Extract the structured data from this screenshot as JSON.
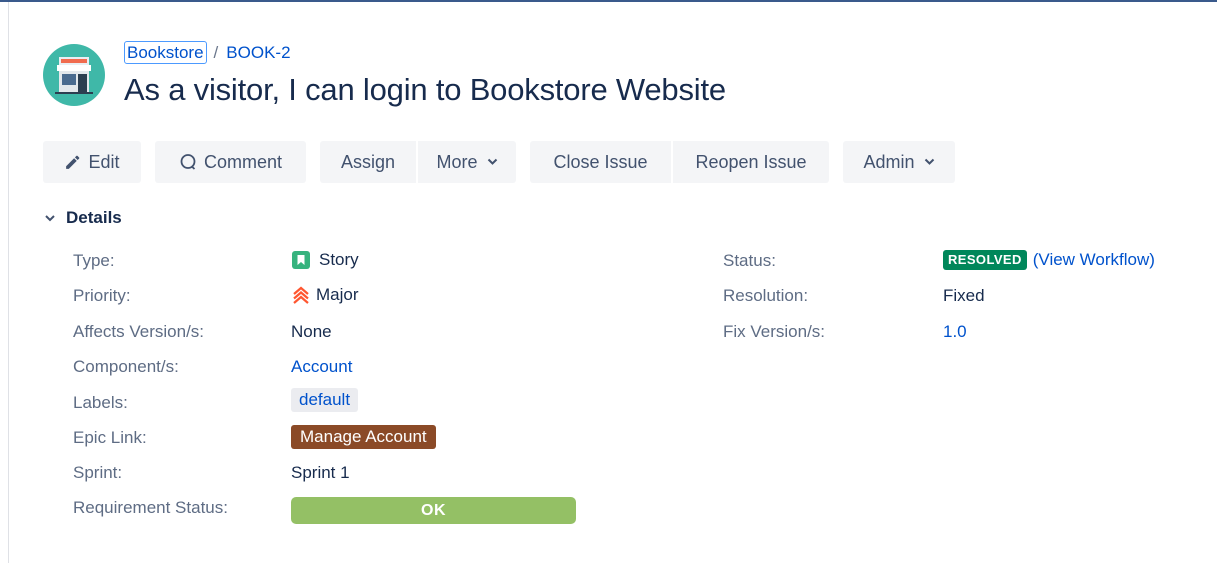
{
  "breadcrumb": {
    "project": "Bookstore",
    "separator": "/",
    "issue_key": "BOOK-2"
  },
  "issue": {
    "title": "As a visitor, I can login to Bookstore Website"
  },
  "avatar": {
    "icon": "bookstore-storefront-icon",
    "color": "#3fb8a8"
  },
  "toolbar": {
    "edit": {
      "label": "Edit",
      "icon": "pencil-icon"
    },
    "comment": {
      "label": "Comment",
      "icon": "comment-icon"
    },
    "assign": {
      "label": "Assign"
    },
    "more": {
      "label": "More"
    },
    "close_issue": {
      "label": "Close Issue"
    },
    "reopen_issue": {
      "label": "Reopen Issue"
    },
    "admin": {
      "label": "Admin"
    }
  },
  "details": {
    "heading": "Details",
    "left_fields": {
      "type": {
        "label": "Type:",
        "value": "Story"
      },
      "priority": {
        "label": "Priority:",
        "value": "Major"
      },
      "affects_versions": {
        "label": "Affects Version/s:",
        "value": "None"
      },
      "components": {
        "label": "Component/s:",
        "value": "Account"
      },
      "labels": {
        "label": "Labels:",
        "value": "default"
      },
      "epic_link": {
        "label": "Epic Link:",
        "value": "Manage Account"
      },
      "sprint": {
        "label": "Sprint:",
        "value": "Sprint 1"
      },
      "requirement_status": {
        "label": "Requirement Status:",
        "value": "OK"
      }
    },
    "right_fields": {
      "status": {
        "label": "Status:",
        "value": "RESOLVED",
        "workflow_link": "(View Workflow)"
      },
      "resolution": {
        "label": "Resolution:",
        "value": "Fixed"
      },
      "fix_versions": {
        "label": "Fix Version/s:",
        "value": "1.0"
      }
    }
  },
  "colors": {
    "link": "#0052cc",
    "button_bg": "#f4f5f7",
    "status_resolved": "#00875a",
    "epic": "#8b4a27",
    "requirement_ok": "#94c065",
    "story_icon": "#36b37e",
    "priority_major": "#ff5630"
  }
}
